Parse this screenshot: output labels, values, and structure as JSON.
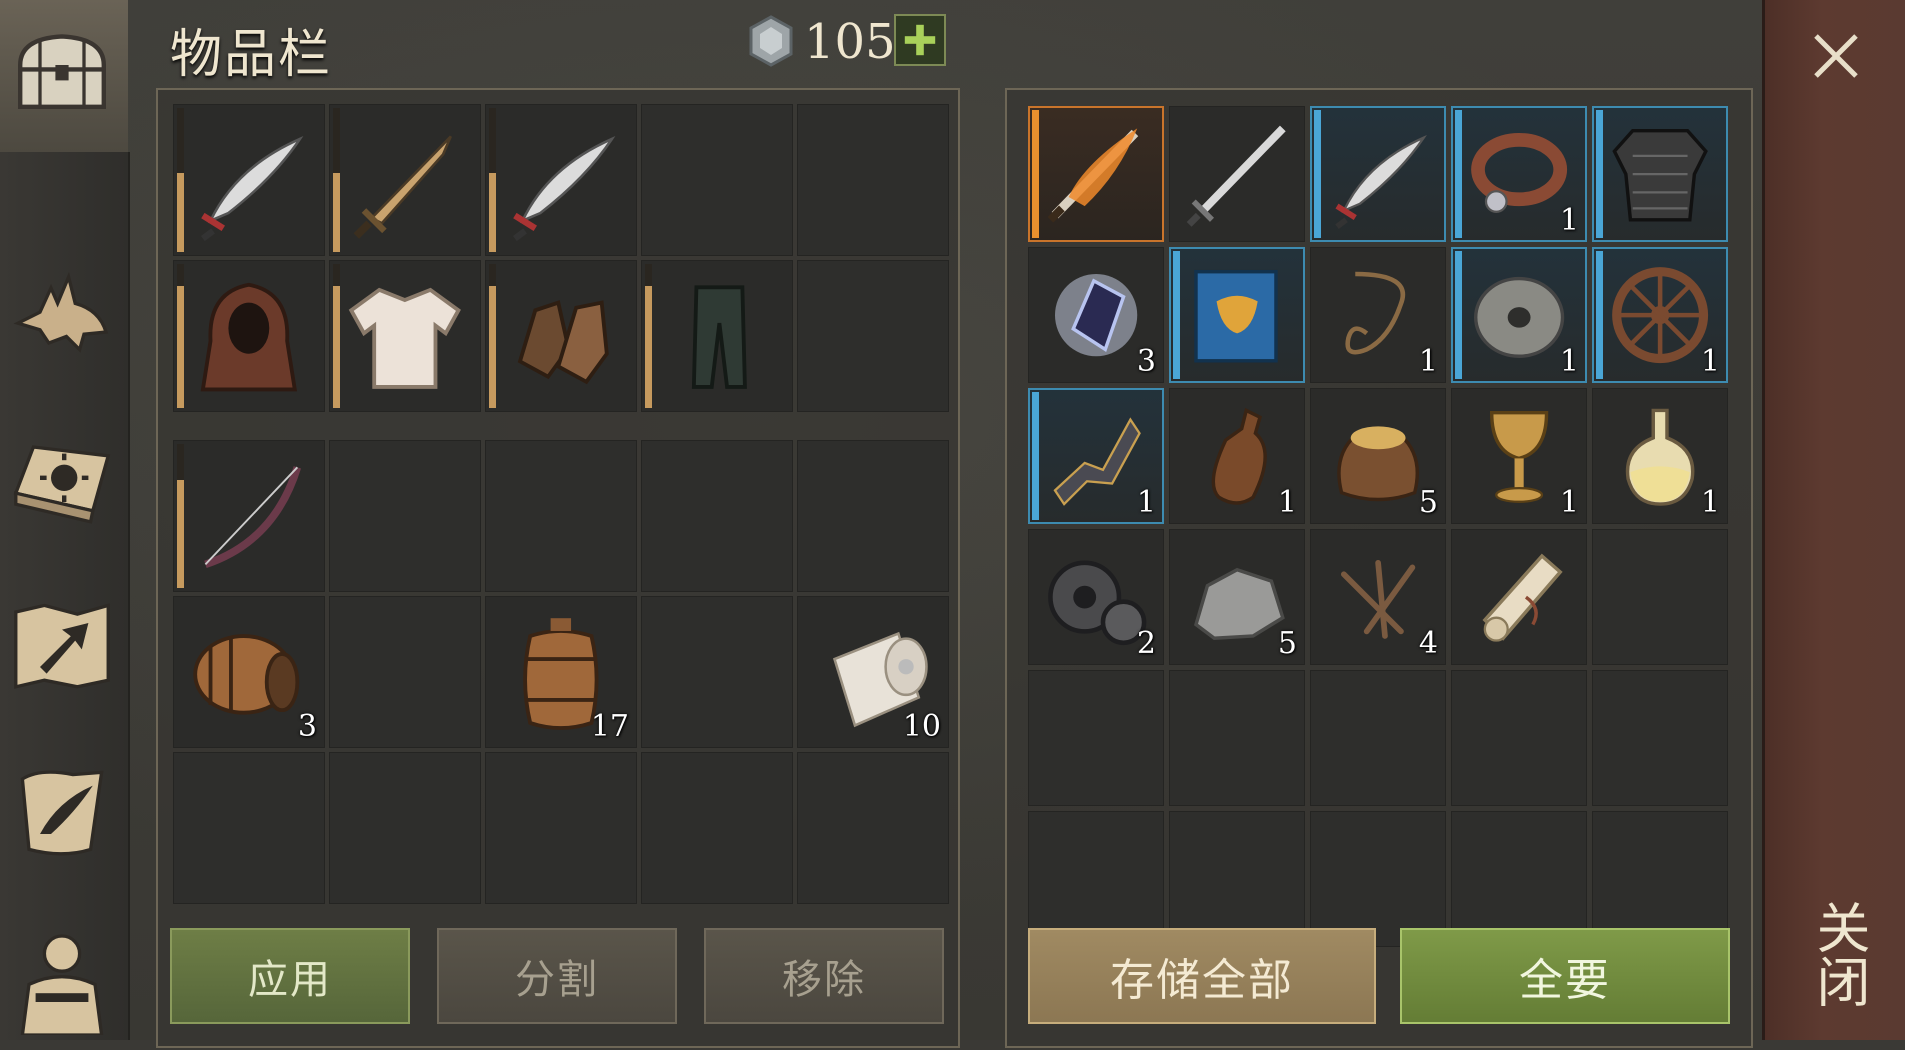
{
  "header": {
    "title": "物品栏",
    "currency_value": "105",
    "add_label": "+"
  },
  "sidebar": {
    "items": [
      "chest-icon",
      "wolf-icon",
      "sun-book-icon",
      "map-arrow-icon",
      "quill-scroll-icon",
      "character-icon"
    ]
  },
  "left_buttons": {
    "apply": "应用",
    "split": "分割",
    "remove": "移除"
  },
  "right_buttons": {
    "store_all": "存储全部",
    "take_all": "全要"
  },
  "close": {
    "label": "关闭"
  },
  "inventory": {
    "equipment_row1": [
      {
        "icon": "scimitar-icon",
        "durability": 0.55
      },
      {
        "icon": "short-sword-icon",
        "durability": 0.55
      },
      {
        "icon": "scimitar-icon",
        "durability": 0.55
      },
      {
        "icon": "",
        "durability": null
      },
      {
        "icon": "",
        "durability": null
      }
    ],
    "equipment_row2": [
      {
        "icon": "hood-icon",
        "durability": 0.85
      },
      {
        "icon": "shirt-icon",
        "durability": 0.85
      },
      {
        "icon": "gloves-icon",
        "durability": 0.85
      },
      {
        "icon": "pants-icon",
        "durability": 0.85
      },
      {
        "icon": "",
        "durability": null
      }
    ],
    "bag_row1": [
      {
        "icon": "bow-icon",
        "durability": 0.75,
        "count": ""
      },
      {
        "icon": "",
        "count": ""
      },
      {
        "icon": "",
        "count": ""
      },
      {
        "icon": "",
        "count": ""
      },
      {
        "icon": "",
        "count": ""
      }
    ],
    "bag_row2": [
      {
        "icon": "barrel-side-icon",
        "count": "3"
      },
      {
        "icon": "",
        "count": ""
      },
      {
        "icon": "barrel-icon",
        "count": "17"
      },
      {
        "icon": "",
        "count": ""
      },
      {
        "icon": "cloth-roll-icon",
        "count": "10"
      }
    ]
  },
  "storage": [
    [
      {
        "icon": "flame-sword-icon",
        "count": "",
        "rarity": "orange"
      },
      {
        "icon": "longsword-icon",
        "count": "",
        "rarity": "none"
      },
      {
        "icon": "scimitar-icon",
        "count": "",
        "rarity": "blue"
      },
      {
        "icon": "collar-icon",
        "count": "1",
        "rarity": "blue"
      },
      {
        "icon": "scale-armor-icon",
        "count": "",
        "rarity": "blue"
      }
    ],
    [
      {
        "icon": "crystal-icon",
        "count": "3",
        "rarity": "none"
      },
      {
        "icon": "blue-book-icon",
        "count": "",
        "rarity": "blue"
      },
      {
        "icon": "rope-icon",
        "count": "1",
        "rarity": "none"
      },
      {
        "icon": "millstone-icon",
        "count": "1",
        "rarity": "blue"
      },
      {
        "icon": "wheel-icon",
        "count": "1",
        "rarity": "blue"
      }
    ],
    [
      {
        "icon": "bow-limb-icon",
        "count": "1",
        "rarity": "blue"
      },
      {
        "icon": "bottle-icon",
        "count": "1",
        "rarity": "none"
      },
      {
        "icon": "grain-sack-icon",
        "count": "5",
        "rarity": "none"
      },
      {
        "icon": "goblet-icon",
        "count": "1",
        "rarity": "none"
      },
      {
        "icon": "potion-icon",
        "count": "1",
        "rarity": "none"
      }
    ],
    [
      {
        "icon": "gears-icon",
        "count": "2",
        "rarity": "none"
      },
      {
        "icon": "stone-icon",
        "count": "5",
        "rarity": "none"
      },
      {
        "icon": "nails-icon",
        "count": "4",
        "rarity": "none"
      },
      {
        "icon": "scroll-icon",
        "count": "",
        "rarity": "none"
      },
      {
        "icon": "",
        "count": "",
        "rarity": "none"
      }
    ],
    [
      {
        "icon": "",
        "count": ""
      },
      {
        "icon": "",
        "count": ""
      },
      {
        "icon": "",
        "count": ""
      },
      {
        "icon": "",
        "count": ""
      },
      {
        "icon": "",
        "count": ""
      }
    ],
    [
      {
        "icon": "",
        "count": ""
      },
      {
        "icon": "",
        "count": ""
      },
      {
        "icon": "",
        "count": ""
      },
      {
        "icon": "",
        "count": ""
      },
      {
        "icon": "",
        "count": ""
      }
    ]
  ]
}
